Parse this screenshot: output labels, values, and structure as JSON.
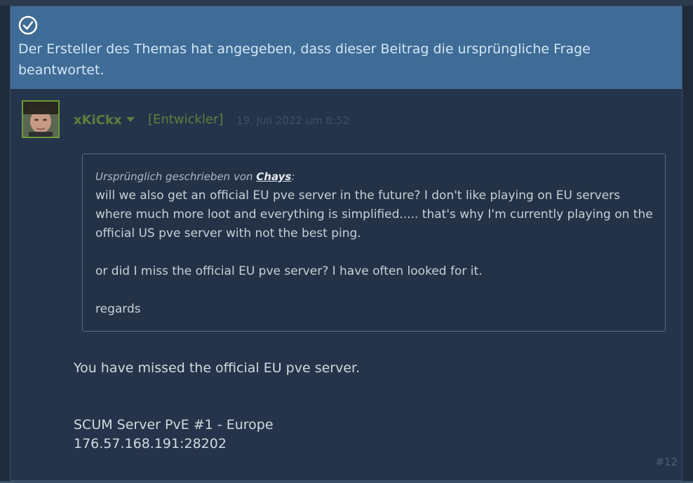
{
  "banner": {
    "text": "Der Ersteller des Themas hat angegeben, dass dieser Beitrag die ursprüngliche Frage beantwortet."
  },
  "post": {
    "author": "xKiCkx",
    "role": "[Entwickler]",
    "date": "19. Juli 2022 um 8:52",
    "number": "#12",
    "quote": {
      "prefix": "Ursprünglich geschrieben von",
      "author": "Chays",
      "suffix": ":",
      "lines": [
        "will we also get an official EU pve server in the future? I don't like playing on EU servers where much more loot and everything is simplified..... that's why I'm currently playing on the official US pve server with not the best ping.",
        "",
        "or did I miss the official EU pve server? I have often looked for it.",
        "",
        "regards"
      ]
    },
    "reply": {
      "line1": "You have missed the official EU pve server.",
      "line2": "SCUM Server PvE #1 - Europe",
      "line3": "176.57.168.191:28202"
    }
  },
  "colors": {
    "banner_bg": "#3f6c96",
    "author_green": "#5e7f3d",
    "panel_bg": "#25344a"
  },
  "icons": {
    "check": "checkmark-circle-icon",
    "dropdown": "chevron-down-icon"
  }
}
